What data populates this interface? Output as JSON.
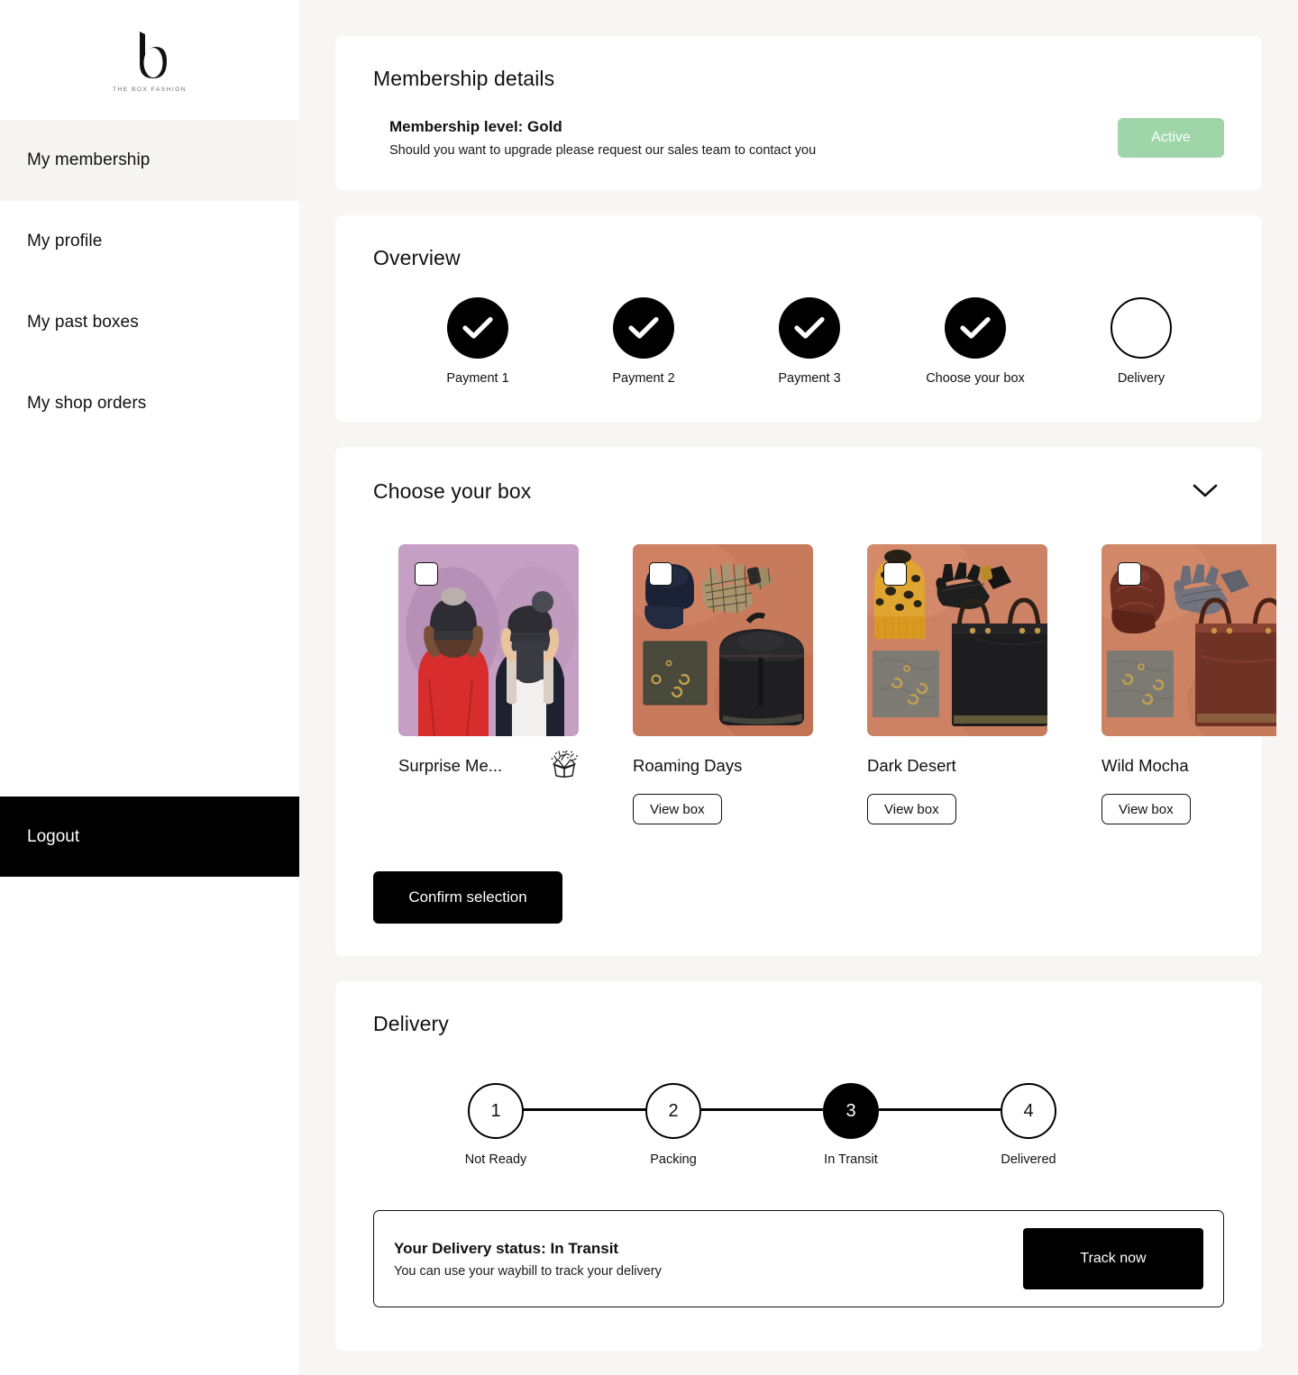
{
  "brand": {
    "mark": "b",
    "tagline": "THE BOX FASHION"
  },
  "sidebar": {
    "items": [
      {
        "label": "My membership",
        "active": true
      },
      {
        "label": "My profile",
        "active": false
      },
      {
        "label": "My past boxes",
        "active": false
      },
      {
        "label": "My shop orders",
        "active": false
      }
    ],
    "logout_label": "Logout"
  },
  "membership": {
    "section_title": "Membership details",
    "level_line": "Membership level: Gold",
    "note": "Should you want to upgrade please request our sales team to contact you",
    "status_label": "Active",
    "status_color": "#9ed5a9"
  },
  "overview": {
    "section_title": "Overview",
    "steps": [
      {
        "label": "Payment 1",
        "state": "done"
      },
      {
        "label": "Payment 2",
        "state": "done"
      },
      {
        "label": "Payment 3",
        "state": "done"
      },
      {
        "label": "Choose your box",
        "state": "done"
      },
      {
        "label": "Delivery",
        "state": "pending"
      }
    ]
  },
  "choose_box": {
    "section_title": "Choose your box",
    "collapse_icon": "chevron-down-icon",
    "boxes": [
      {
        "name": "Surprise Me...",
        "selected": false,
        "has_view_button": false,
        "icon": "surprise-box-icon",
        "image": "two women in beanies on purple background"
      },
      {
        "name": "Roaming Days",
        "selected": false,
        "has_view_button": true,
        "view_label": "View box",
        "image": "navy cap, plaid gloves, black backpack on terracotta"
      },
      {
        "name": "Dark Desert",
        "selected": false,
        "has_view_button": true,
        "view_label": "View box",
        "image": "leopard beanie, black gloves, black tote on terracotta"
      },
      {
        "name": "Wild Mocha",
        "selected": false,
        "has_view_button": true,
        "view_label": "View box",
        "image": "brown leather cap, grey gloves, brown tote on terracotta"
      }
    ],
    "confirm_label": "Confirm selection"
  },
  "delivery": {
    "section_title": "Delivery",
    "steps": [
      {
        "number": "1",
        "label": "Not Ready",
        "current": false
      },
      {
        "number": "2",
        "label": "Packing",
        "current": false
      },
      {
        "number": "3",
        "label": "In Transit",
        "current": true
      },
      {
        "number": "4",
        "label": "Delivered",
        "current": false
      }
    ],
    "status_title": "Your Delivery status: In Transit",
    "status_sub": "You can use your waybill to track your delivery",
    "track_label": "Track now"
  }
}
